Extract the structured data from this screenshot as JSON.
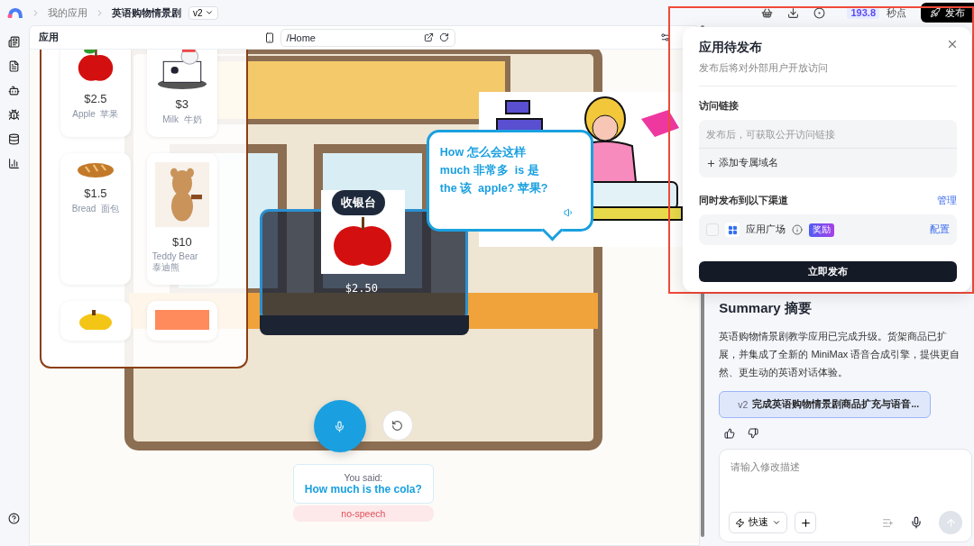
{
  "topbar": {
    "breadcrumbs": [
      {
        "label": "我的应用"
      },
      {
        "label": "英语购物情景剧"
      }
    ],
    "version": "v2",
    "credits": {
      "value": "193.8",
      "unit": "秒点"
    },
    "publish": "发布"
  },
  "preview": {
    "title": "应用",
    "url": "/Home",
    "products": [
      {
        "kind": "card",
        "price": "$2.5",
        "name": "Apple  苹果"
      },
      {
        "kind": "card",
        "price": "$3",
        "name": "Milk  牛奶"
      },
      {
        "kind": "card",
        "price": "$1.5",
        "name": "Bread  面包"
      },
      {
        "kind": "card",
        "price": "$10",
        "name": "Teddy Bear  泰迪熊"
      },
      {
        "kind": "partial"
      },
      {
        "kind": "partial"
      }
    ],
    "bubble": [
      {
        "en": "How",
        "zh": "怎么会这样"
      },
      {
        "en": "much",
        "zh": "非常多"
      },
      {
        "en": "is",
        "zh": "是"
      },
      {
        "en": "the",
        "zh": "该"
      },
      {
        "en": "apple?",
        "zh": "苹果?"
      }
    ],
    "counter": {
      "label": "收银台",
      "price": "$2.50"
    },
    "voice": {
      "label": "You said:",
      "transcript": "How much is the cola?",
      "status": "no-speech"
    }
  },
  "summary": {
    "title": "Summary  摘要",
    "text": "英语购物情景剧教学应用已完成升级。货架商品已扩展，并集成了全新的 MiniMax 语音合成引擎，提供更自然、更生动的英语对话体验。",
    "version": "v2",
    "version_title": "完成英语购物情景剧商品扩充与语音...",
    "input_placeholder": "请输入修改描述",
    "mode": "快速"
  },
  "dialog": {
    "title": "应用待发布",
    "subtitle": "发布后将对外部用户开放访问",
    "link_label": "访问链接",
    "link_placeholder": "发布后，可获取公开访问链接",
    "add_domain": "添加专属域名",
    "channels_label": "同时发布到以下渠道",
    "manage": "管理",
    "channels": [
      {
        "name": "应用广场",
        "badge": "奖励",
        "action": "配置",
        "checked": false
      }
    ],
    "submit": "立即发布"
  }
}
